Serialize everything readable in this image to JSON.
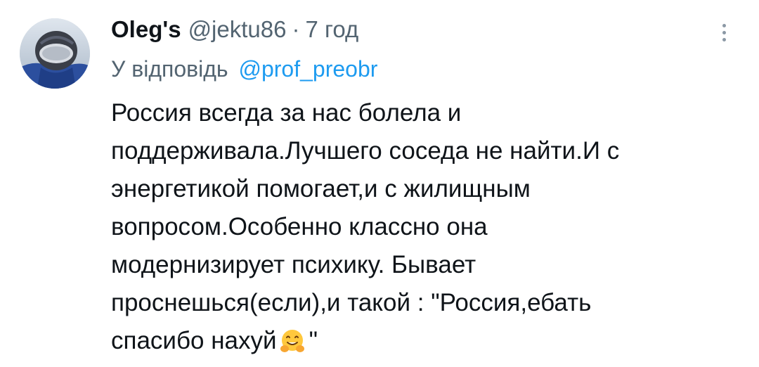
{
  "tweet": {
    "display_name": "Oleg's",
    "handle": "@jektu86",
    "separator": "·",
    "time": "7 год",
    "reply_prefix": "У відповідь",
    "reply_to": "@prof_preobr",
    "lines": [
      "Россия всегда за нас болела и",
      "поддерживала.Лучшего соседа не найти.И с",
      "энергетикой помогает,и с жилищным",
      "вопросом.Особенно классно она",
      "модернизирует психику. Бывает",
      "проснешься(если),и такой : \"Россия,ебать",
      "спасибо нахуй"
    ],
    "last_line_suffix": "\"",
    "emoji_name": "hugging-face-emoji",
    "icons": {
      "avatar": "avatar-photo",
      "more": "more-options-icon"
    }
  }
}
